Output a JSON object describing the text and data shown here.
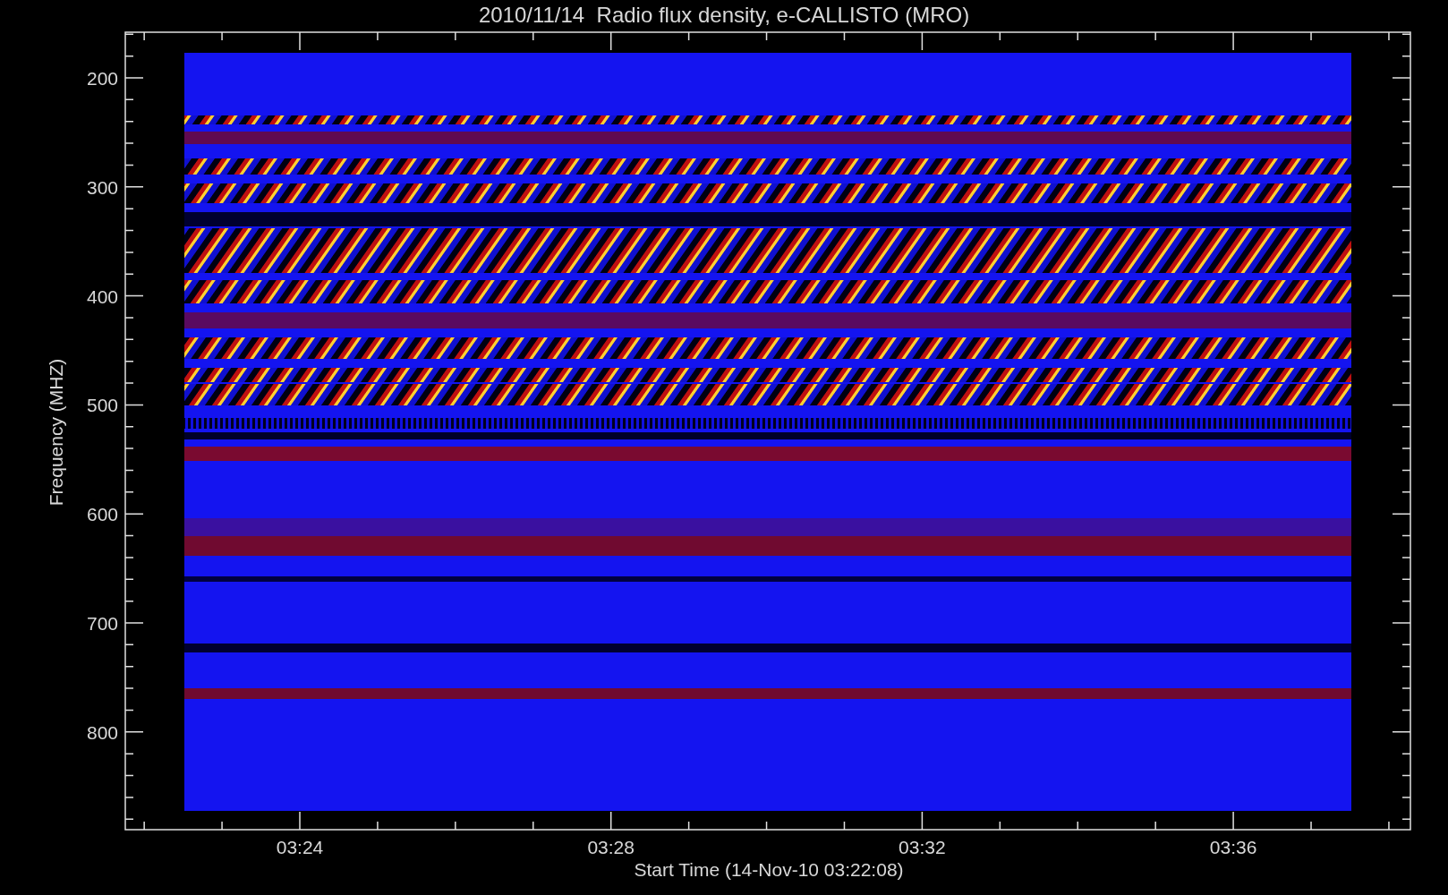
{
  "title": "2010/11/14  Radio flux density, e-CALLISTO (MRO)",
  "xlabel": "Start Time (14-Nov-10 03:22:08)",
  "ylabel": "Frequency (MHZ)",
  "xticks": [
    "03:24",
    "03:28",
    "03:32",
    "03:36"
  ],
  "yticks": [
    "200",
    "300",
    "400",
    "500",
    "600",
    "700",
    "800"
  ]
}
